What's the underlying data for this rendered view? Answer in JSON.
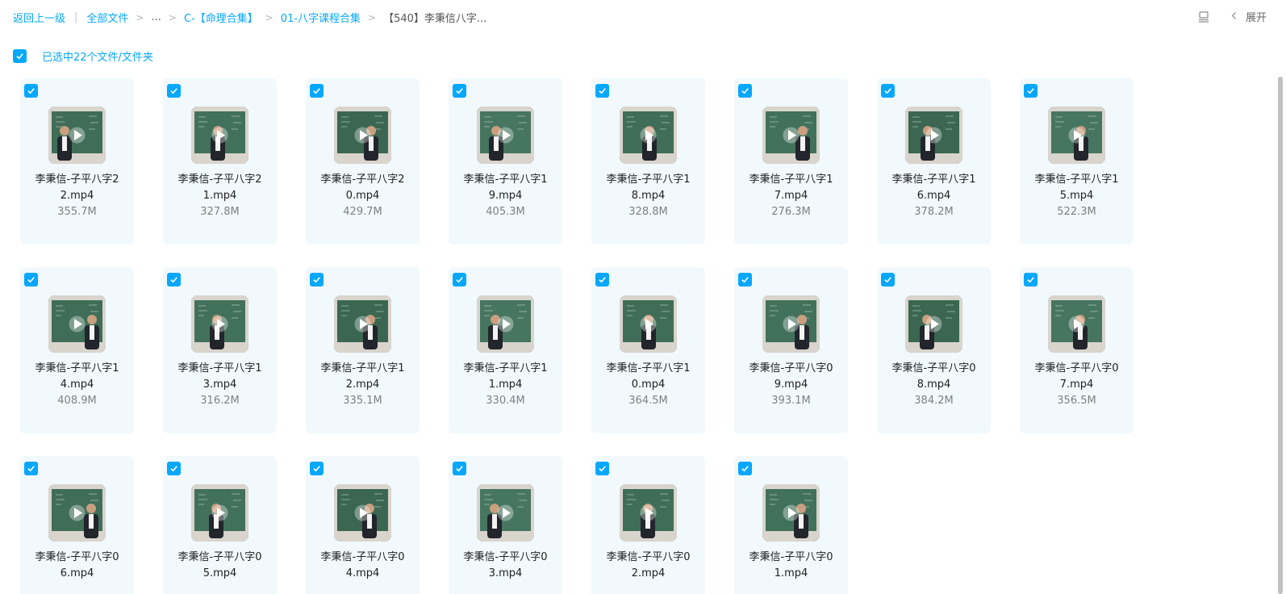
{
  "breadcrumb": {
    "back": "返回上一级",
    "all_files": "全部文件",
    "ellipsis": "...",
    "level1": "C-【命理合集】",
    "level2": "01-八字课程合集",
    "current": "【540】李秉信八字..."
  },
  "toolbar": {
    "view_icon": "list-view-icon",
    "expand_label": "展开",
    "expand_icon": "chevron-left-icon"
  },
  "selection": {
    "label": "已选中22个文件/文件夹",
    "checked": true
  },
  "files": [
    {
      "name_line1": "李秉信-子平八字2",
      "name_line2": "2.mp4",
      "size": "355.7M",
      "checked": true
    },
    {
      "name_line1": "李秉信-子平八字2",
      "name_line2": "1.mp4",
      "size": "327.8M",
      "checked": true
    },
    {
      "name_line1": "李秉信-子平八字2",
      "name_line2": "0.mp4",
      "size": "429.7M",
      "checked": true
    },
    {
      "name_line1": "李秉信-子平八字1",
      "name_line2": "9.mp4",
      "size": "405.3M",
      "checked": true
    },
    {
      "name_line1": "李秉信-子平八字1",
      "name_line2": "8.mp4",
      "size": "328.8M",
      "checked": true
    },
    {
      "name_line1": "李秉信-子平八字1",
      "name_line2": "7.mp4",
      "size": "276.3M",
      "checked": true
    },
    {
      "name_line1": "李秉信-子平八字1",
      "name_line2": "6.mp4",
      "size": "378.2M",
      "checked": true
    },
    {
      "name_line1": "李秉信-子平八字1",
      "name_line2": "5.mp4",
      "size": "522.3M",
      "checked": true
    },
    {
      "name_line1": "李秉信-子平八字1",
      "name_line2": "4.mp4",
      "size": "408.9M",
      "checked": true
    },
    {
      "name_line1": "李秉信-子平八字1",
      "name_line2": "3.mp4",
      "size": "316.2M",
      "checked": true
    },
    {
      "name_line1": "李秉信-子平八字1",
      "name_line2": "2.mp4",
      "size": "335.1M",
      "checked": true
    },
    {
      "name_line1": "李秉信-子平八字1",
      "name_line2": "1.mp4",
      "size": "330.4M",
      "checked": true
    },
    {
      "name_line1": "李秉信-子平八字1",
      "name_line2": "0.mp4",
      "size": "364.5M",
      "checked": true
    },
    {
      "name_line1": "李秉信-子平八字0",
      "name_line2": "9.mp4",
      "size": "393.1M",
      "checked": true
    },
    {
      "name_line1": "李秉信-子平八字0",
      "name_line2": "8.mp4",
      "size": "384.2M",
      "checked": true
    },
    {
      "name_line1": "李秉信-子平八字0",
      "name_line2": "7.mp4",
      "size": "356.5M",
      "checked": true
    },
    {
      "name_line1": "李秉信-子平八字0",
      "name_line2": "6.mp4",
      "size": "",
      "checked": true
    },
    {
      "name_line1": "李秉信-子平八字0",
      "name_line2": "5.mp4",
      "size": "",
      "checked": true
    },
    {
      "name_line1": "李秉信-子平八字0",
      "name_line2": "4.mp4",
      "size": "",
      "checked": true
    },
    {
      "name_line1": "李秉信-子平八字0",
      "name_line2": "3.mp4",
      "size": "",
      "checked": true
    },
    {
      "name_line1": "李秉信-子平八字0",
      "name_line2": "2.mp4",
      "size": "",
      "checked": true
    },
    {
      "name_line1": "李秉信-子平八字0",
      "name_line2": "1.mp4",
      "size": "",
      "checked": true
    }
  ],
  "colors": {
    "accent": "#06a7ff",
    "card_bg": "#f1f9fd",
    "blackboard": "#3c6a55"
  }
}
